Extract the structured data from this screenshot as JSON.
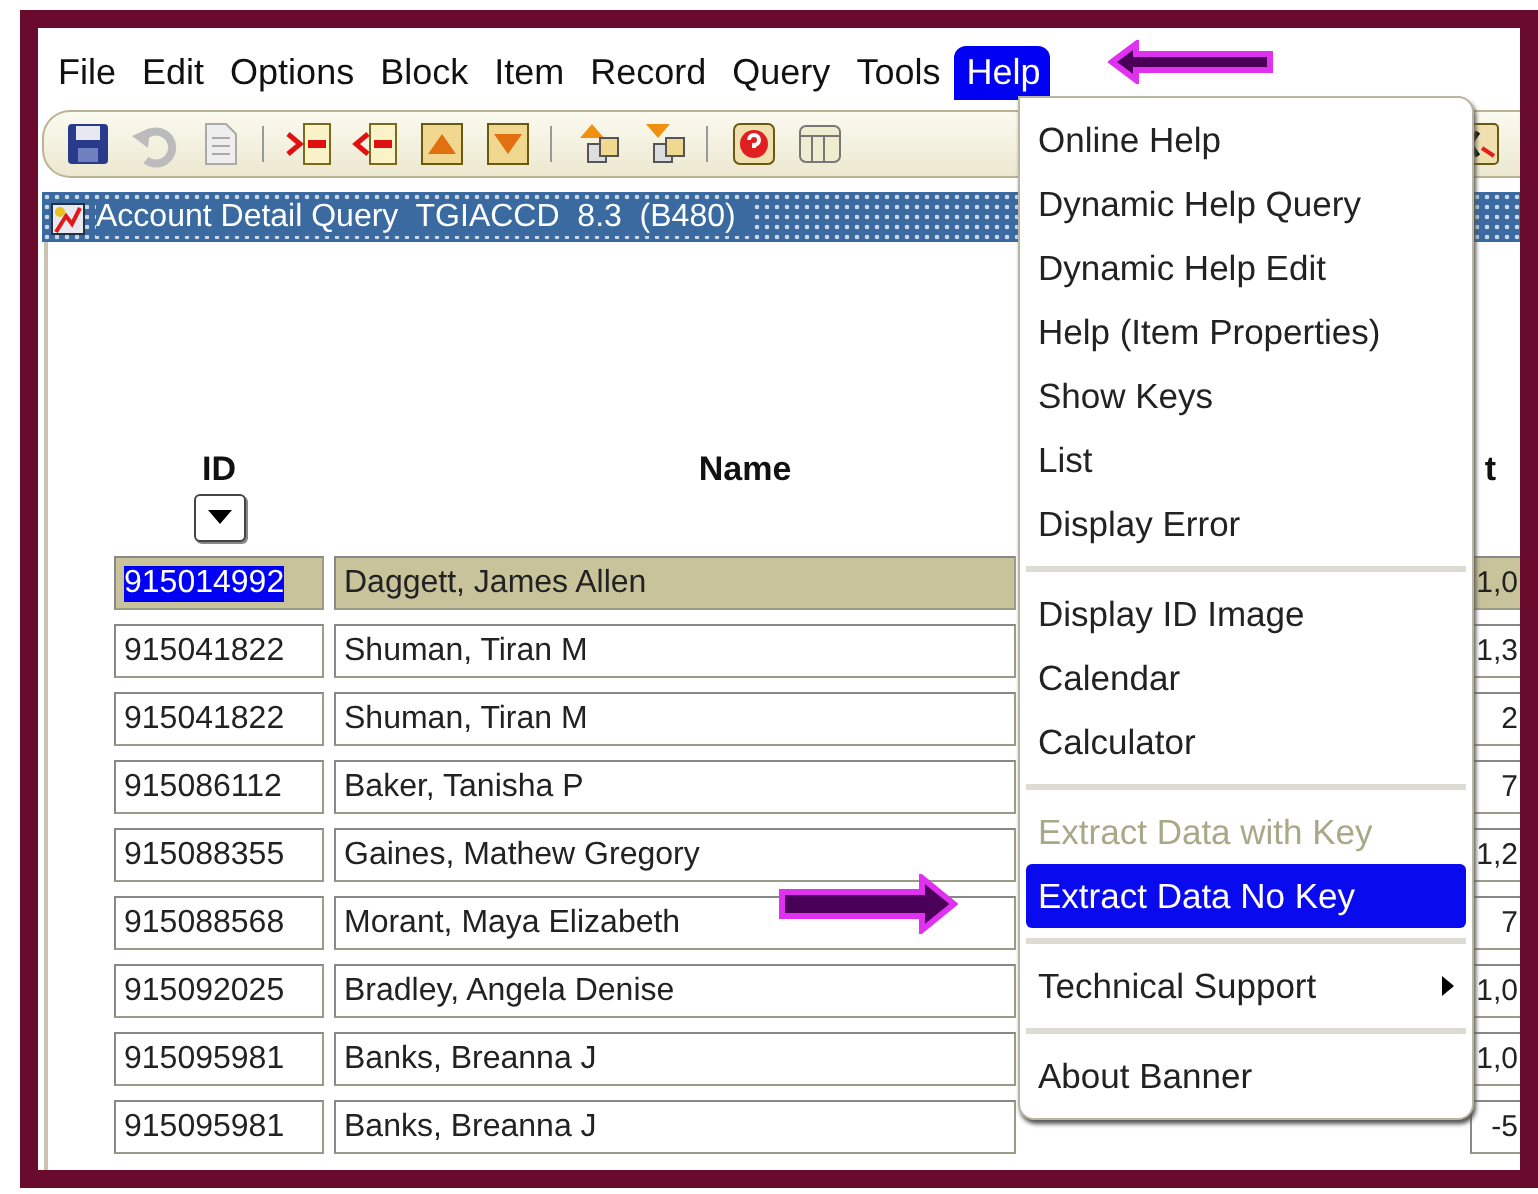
{
  "menu_bar": [
    {
      "label": "File",
      "selected": false
    },
    {
      "label": "Edit",
      "selected": false
    },
    {
      "label": "Options",
      "selected": false
    },
    {
      "label": "Block",
      "selected": false
    },
    {
      "label": "Item",
      "selected": false
    },
    {
      "label": "Record",
      "selected": false
    },
    {
      "label": "Query",
      "selected": false
    },
    {
      "label": "Tools",
      "selected": false
    },
    {
      "label": "Help",
      "selected": true
    }
  ],
  "form_title": "Account Detail Query  TGIACCD  8.3  (B480)",
  "table": {
    "columns": [
      "ID",
      "Name",
      "t"
    ],
    "rows": [
      {
        "id": "915014992",
        "name": "Daggett, James Allen",
        "column_3": "1,0",
        "selected": true
      },
      {
        "id": "915041822",
        "name": "Shuman, Tiran M",
        "column_3": "1,3",
        "selected": false
      },
      {
        "id": "915041822",
        "name": "Shuman, Tiran M",
        "column_3": "2",
        "selected": false
      },
      {
        "id": "915086112",
        "name": "Baker, Tanisha P",
        "column_3": "7",
        "selected": false
      },
      {
        "id": "915088355",
        "name": "Gaines, Mathew Gregory",
        "column_3": "1,2",
        "selected": false
      },
      {
        "id": "915088568",
        "name": "Morant, Maya Elizabeth",
        "column_3": "7",
        "selected": false
      },
      {
        "id": "915092025",
        "name": "Bradley, Angela Denise",
        "column_3": "1,0",
        "selected": false
      },
      {
        "id": "915095981",
        "name": "Banks, Breanna J",
        "column_3": "1,0",
        "selected": false
      },
      {
        "id": "915095981",
        "name": "Banks, Breanna J",
        "column_3": "-5",
        "selected": false
      }
    ]
  },
  "help_menu": [
    {
      "kind": "item",
      "label": "Online Help",
      "disabled": false,
      "selected": false
    },
    {
      "kind": "item",
      "label": "Dynamic Help Query",
      "disabled": false,
      "selected": false
    },
    {
      "kind": "item",
      "label": "Dynamic Help Edit",
      "disabled": false,
      "selected": false
    },
    {
      "kind": "item",
      "label": "Help (Item Properties)",
      "disabled": false,
      "selected": false
    },
    {
      "kind": "item",
      "label": "Show Keys",
      "disabled": false,
      "selected": false
    },
    {
      "kind": "item",
      "label": "List",
      "disabled": false,
      "selected": false
    },
    {
      "kind": "item",
      "label": "Display Error",
      "disabled": false,
      "selected": false
    },
    {
      "kind": "separator"
    },
    {
      "kind": "item",
      "label": "Display ID Image",
      "disabled": false,
      "selected": false
    },
    {
      "kind": "item",
      "label": "Calendar",
      "disabled": false,
      "selected": false
    },
    {
      "kind": "item",
      "label": "Calculator",
      "disabled": false,
      "selected": false
    },
    {
      "kind": "separator"
    },
    {
      "kind": "item",
      "label": "Extract Data with Key",
      "disabled": true,
      "selected": false
    },
    {
      "kind": "item",
      "label": "Extract Data No Key",
      "disabled": false,
      "selected": true
    },
    {
      "kind": "separator"
    },
    {
      "kind": "submenu",
      "label": "Technical Support",
      "disabled": false,
      "selected": false
    },
    {
      "kind": "separator"
    },
    {
      "kind": "item",
      "label": "About Banner",
      "disabled": false,
      "selected": false
    }
  ]
}
